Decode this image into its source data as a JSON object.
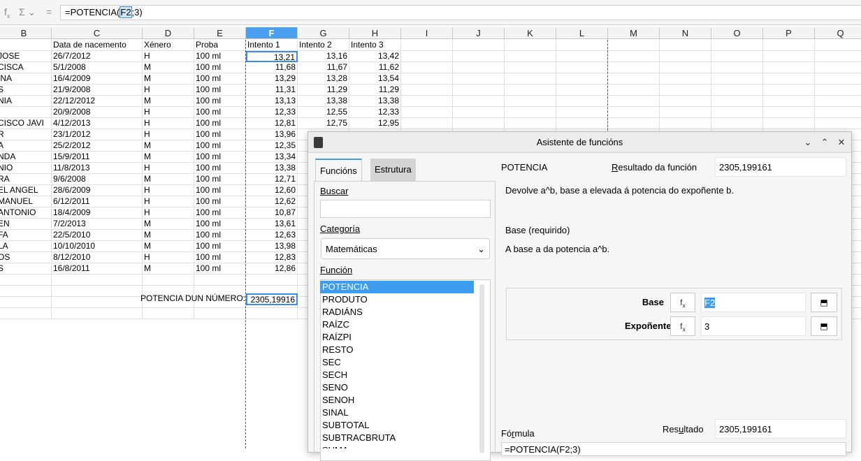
{
  "formula_bar": {
    "function_icon": "fx-icon",
    "sum_icon": "sum-icon",
    "equals_icon": "equals-icon",
    "formula_prefix": "=POTENCIA(",
    "formula_ref": "F2",
    "formula_suffix": ";3)"
  },
  "columns": [
    "B",
    "C",
    "D",
    "E",
    "F",
    "G",
    "H",
    "I",
    "J",
    "K",
    "L",
    "M",
    "N",
    "O",
    "P",
    "Q"
  ],
  "header_row": [
    "",
    "Data de nacemento",
    "Xénero",
    "Proba",
    "Intento 1",
    "Intento 2",
    "Intento 3"
  ],
  "rows": [
    [
      "JOSE",
      "26/7/2012",
      "H",
      "100 ml",
      "13,21",
      "13,16",
      "13,42"
    ],
    [
      "CISCA",
      "5/1/2008",
      "M",
      "100 ml",
      "11,68",
      "11,67",
      "11,62"
    ],
    [
      "INA",
      "16/4/2009",
      "M",
      "100 ml",
      "13,29",
      "13,28",
      "13,54"
    ],
    [
      "S",
      "21/9/2008",
      "H",
      "100 ml",
      "11,31",
      "11,29",
      "11,29"
    ],
    [
      "NIA",
      "22/12/2012",
      "M",
      "100 ml",
      "13,13",
      "13,38",
      "13,38"
    ],
    [
      "",
      "20/9/2008",
      "H",
      "100 ml",
      "12,33",
      "12,55",
      "12,33"
    ],
    [
      "CISCO JAVI",
      "4/12/2013",
      "H",
      "100 ml",
      "12,81",
      "12,75",
      "12,95"
    ],
    [
      "R",
      "23/1/2012",
      "H",
      "100 ml",
      "13,96",
      "",
      ""
    ],
    [
      "A",
      "25/2/2012",
      "M",
      "100 ml",
      "12,35",
      "",
      ""
    ],
    [
      "NDA",
      "15/9/2011",
      "M",
      "100 ml",
      "13,34",
      "",
      ""
    ],
    [
      "NIO",
      "11/8/2013",
      "H",
      "100 ml",
      "13,38",
      "",
      ""
    ],
    [
      "RA",
      "9/6/2008",
      "M",
      "100 ml",
      "12,71",
      "",
      ""
    ],
    [
      "EL ANGEL",
      "28/6/2009",
      "H",
      "100 ml",
      "12,60",
      "",
      ""
    ],
    [
      "MANUEL",
      "6/12/2011",
      "H",
      "100 ml",
      "12,62",
      "",
      ""
    ],
    [
      "ANTONIO",
      "18/4/2009",
      "H",
      "100 ml",
      "10,87",
      "",
      ""
    ],
    [
      "EN",
      "7/2/2013",
      "M",
      "100 ml",
      "13,61",
      "",
      ""
    ],
    [
      "FA",
      "22/5/2010",
      "M",
      "100 ml",
      "12,63",
      "",
      ""
    ],
    [
      "LA",
      "10/10/2010",
      "M",
      "100 ml",
      "13,98",
      "",
      ""
    ],
    [
      "OS",
      "8/12/2010",
      "H",
      "100 ml",
      "12,83",
      "",
      ""
    ],
    [
      "S",
      "16/8/2011",
      "M",
      "100 ml",
      "12,86",
      "",
      ""
    ]
  ],
  "potencia_label": "POTENCIA DUN NÚMERO:",
  "potencia_value": "2305,19916",
  "dialog": {
    "title": "Asistente de funcións",
    "tab_functions": "Funcións",
    "tab_structure": "Estrutura",
    "search_label": "Buscar",
    "category_label": "Categoría",
    "category_value": "Matemáticas",
    "function_label": "Función",
    "functions": [
      "POTENCIA",
      "PRODUTO",
      "RADIÁNS",
      "RAÍZC",
      "RAÍZPI",
      "RESTO",
      "SEC",
      "SECH",
      "SENO",
      "SENOH",
      "SINAL",
      "SUBTOTAL",
      "SUBTRACBRUTA",
      "SUMA"
    ],
    "func_name": "POTENCIA",
    "result_label": "Resultado da función",
    "result_value": "2305,199161",
    "description": "Devolve a^b, base a elevada á potencia do expoñente b.",
    "arg_title": "Base (requirido)",
    "arg_desc": "A base a da potencia a^b.",
    "base_label": "Base",
    "base_value": "F2",
    "exp_label": "Expoñente",
    "exp_value": "3",
    "formula_label": "Fórmula",
    "result2_label": "Resultado",
    "result2_value": "2305,199161",
    "formula_text": "=POTENCIA(F2;3)"
  }
}
